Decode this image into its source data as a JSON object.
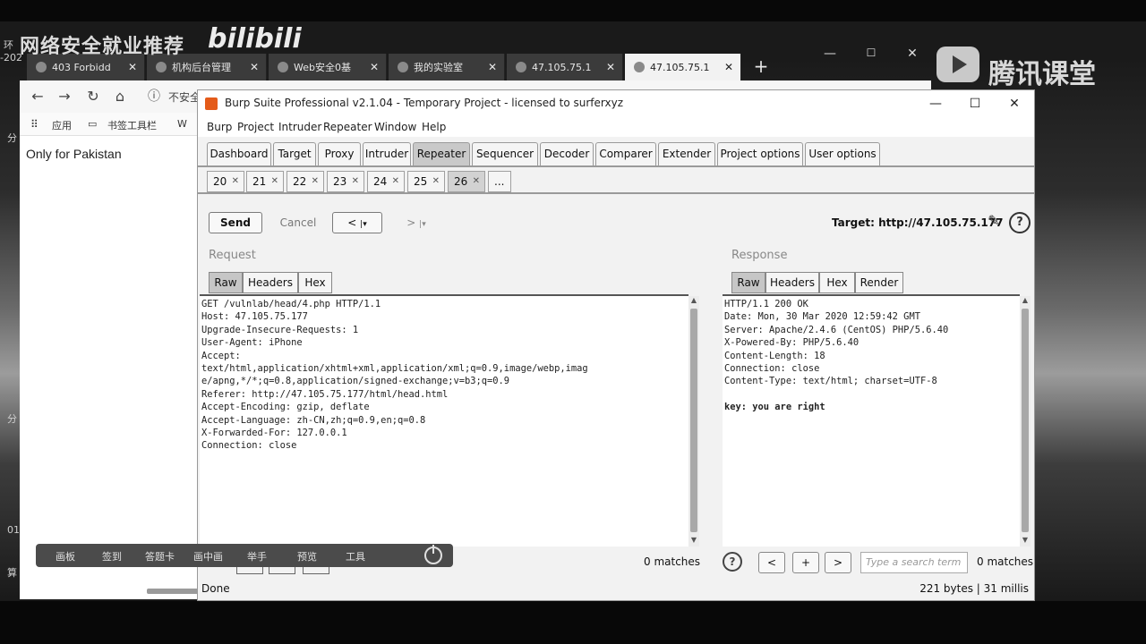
{
  "watermarks": {
    "left": "网络安全就业推荐",
    "bili": "bilibili",
    "tencent": "腾讯课堂",
    "edge": [
      "环",
      "-202",
      "分",
      "分",
      "01",
      "算"
    ]
  },
  "browser": {
    "tabs": [
      {
        "label": "403 Forbidd"
      },
      {
        "label": "机构后台管理"
      },
      {
        "label": "Web安全0基"
      },
      {
        "label": "我的实验室"
      },
      {
        "label": "47.105.75.1"
      },
      {
        "label": "47.105.75.1"
      }
    ],
    "new_tab": "+",
    "insecure": "不安全",
    "bookmarks": [
      "应用",
      "书签工具栏",
      "W"
    ],
    "page_text": "Only for Pakistan"
  },
  "burp": {
    "title": "Burp Suite Professional v2.1.04 - Temporary Project - licensed to surferxyz",
    "menu": [
      "Burp",
      "Project",
      "Intruder",
      "Repeater",
      "Window",
      "Help"
    ],
    "tabs": [
      "Dashboard",
      "Target",
      "Proxy",
      "Intruder",
      "Repeater",
      "Sequencer",
      "Decoder",
      "Comparer",
      "Extender",
      "Project options",
      "User options"
    ],
    "active_tab": "Repeater",
    "repeater_tabs": [
      "20",
      "21",
      "22",
      "23",
      "24",
      "25",
      "26",
      "..."
    ],
    "send": "Send",
    "cancel": "Cancel",
    "back": "<",
    "forward": ">",
    "target": "Target: http://47.105.75.177",
    "request": {
      "title": "Request",
      "tabs": [
        "Raw",
        "Headers",
        "Hex"
      ],
      "lines": [
        "GET /vulnlab/head/4.php HTTP/1.1",
        "Host: 47.105.75.177",
        "Upgrade-Insecure-Requests: 1",
        "User-Agent: iPhone",
        "Accept:",
        "text/html,application/xhtml+xml,application/xml;q=0.9,image/webp,imag",
        "e/apng,*/*;q=0.8,application/signed-exchange;v=b3;q=0.9",
        "Referer: http://47.105.75.177/html/head.html",
        "Accept-Encoding: gzip, deflate",
        "Accept-Language: zh-CN,zh;q=0.9,en;q=0.8",
        "X-Forwarded-For: 127.0.0.1",
        "Connection: close"
      ],
      "matches": "0 matches"
    },
    "response": {
      "title": "Response",
      "tabs": [
        "Raw",
        "Headers",
        "Hex",
        "Render"
      ],
      "lines": [
        "HTTP/1.1 200 OK",
        "Date: Mon, 30 Mar 2020 12:59:42 GMT",
        "Server: Apache/2.4.6 (CentOS) PHP/5.6.40",
        "X-Powered-By: PHP/5.6.40",
        "Content-Length: 18",
        "Connection: close",
        "Content-Type: text/html; charset=UTF-8",
        "",
        "key: you are right"
      ],
      "search_placeholder": "Type a search term",
      "matches": "0 matches",
      "help": "?",
      "prev": "<",
      "add": "+",
      "next": ">"
    },
    "status_left": "Done",
    "status_right": "221 bytes | 31 millis"
  },
  "overlay_toolbar": [
    "画板",
    "签到",
    "答题卡",
    "画中画",
    "举手",
    "预览",
    "工具"
  ]
}
